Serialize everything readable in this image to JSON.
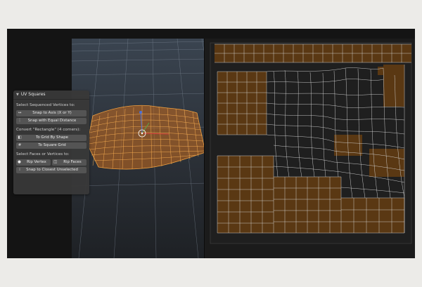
{
  "panel": {
    "title": "UV Squares",
    "section_sequenced": "Select Sequenced Vertices to:",
    "snap_axis_label": "Snap to Axis (X or Y)",
    "snap_equal_label": "Snap with Equal Distance",
    "section_convert": "Convert \"Rectangle\" (4 corners):",
    "grid_by_shape_label": "To Grid By Shape",
    "square_grid_label": "To Square Grid",
    "section_faces": "Select Faces or Vertices to:",
    "rip_vertex_label": "Rip Vertex",
    "rip_faces_label": "Rip Faces",
    "snap_closest_label": "Snap to Closest Unselected"
  },
  "icons": {
    "snap_axis": "horizontal-arrows-icon",
    "snap_equal": "vertical-dots-icon",
    "grid_by_shape": "square-grid-icon",
    "square_grid": "hash-grid-icon",
    "rip_vertex": "dot-icon",
    "rip_faces": "split-faces-icon",
    "snap_closest": "snap-icon"
  },
  "colors": {
    "mesh_orange": "#e08a2c",
    "uv_face_fill": "#5a3813",
    "uv_line": "#d8d8d8",
    "panel_bg": "#383838",
    "button_bg": "#545454"
  }
}
